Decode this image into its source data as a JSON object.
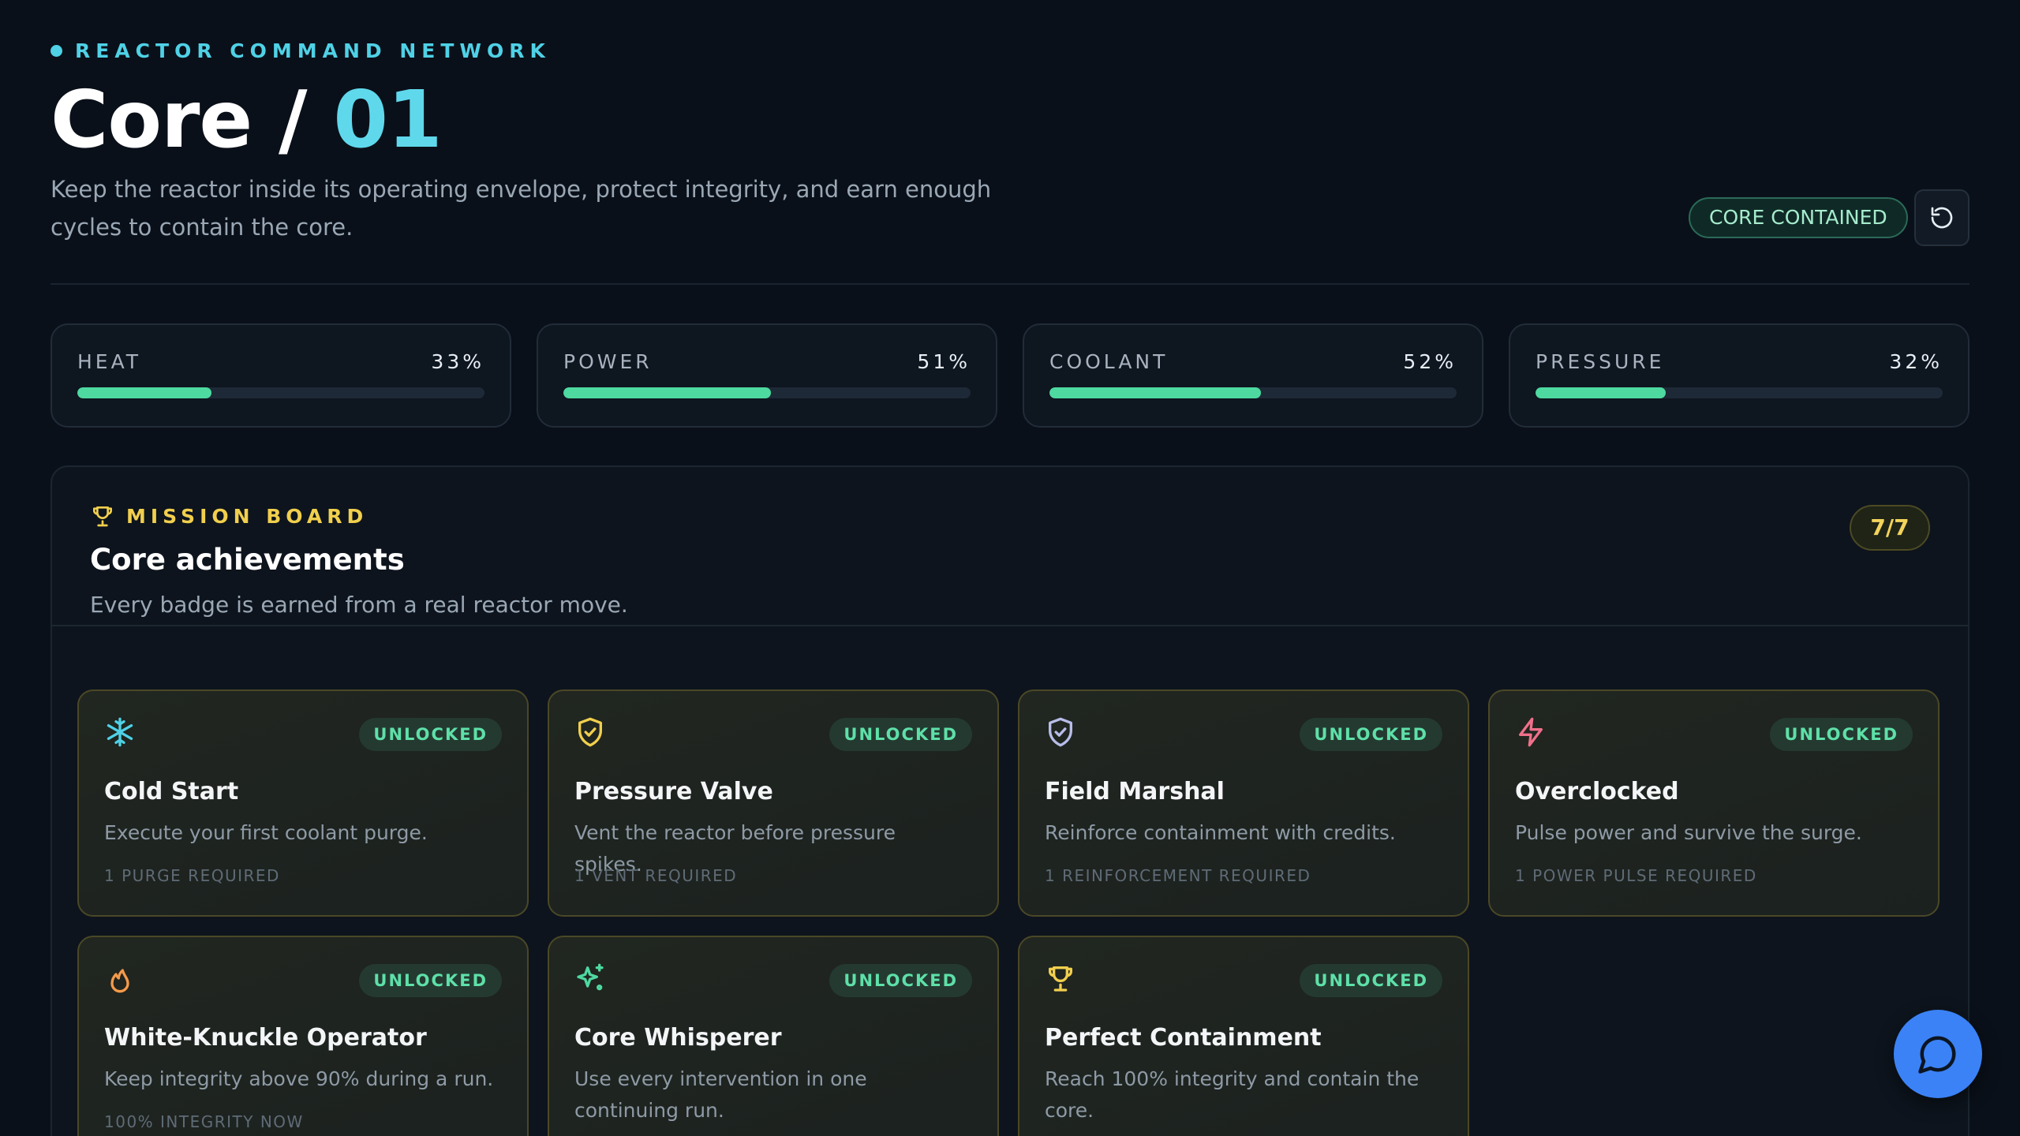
{
  "header": {
    "eyebrow": "REACTOR COMMAND NETWORK",
    "title_main": "Core / ",
    "title_accent": "01",
    "subtitle": "Keep the reactor inside its operating envelope, protect integrity, and earn enough cycles to contain the core.",
    "status": "CORE CONTAINED",
    "reset_icon": "reset-icon"
  },
  "meters": [
    {
      "label": "HEAT",
      "value_text": "33%",
      "value": 0.33
    },
    {
      "label": "POWER",
      "value_text": "51%",
      "value": 0.51
    },
    {
      "label": "COOLANT",
      "value_text": "52%",
      "value": 0.52
    },
    {
      "label": "PRESSURE",
      "value_text": "32%",
      "value": 0.32
    }
  ],
  "board": {
    "eyebrow": "MISSION BOARD",
    "title": "Core achievements",
    "subtitle": "Every badge is earned from a real reactor move.",
    "count": "7/7"
  },
  "achievements": [
    {
      "icon": "snowflake-icon",
      "status": "UNLOCKED",
      "title": "Cold Start",
      "desc": "Execute your first coolant purge.",
      "req": "1 PURGE REQUIRED"
    },
    {
      "icon": "shield-check-icon",
      "status": "UNLOCKED",
      "title": "Pressure Valve",
      "desc": "Vent the reactor before pressure spikes.",
      "req": "1 VENT REQUIRED"
    },
    {
      "icon": "shield-check-icon",
      "status": "UNLOCKED",
      "title": "Field Marshal",
      "desc": "Reinforce containment with credits.",
      "req": "1 REINFORCEMENT REQUIRED"
    },
    {
      "icon": "lightning-icon",
      "status": "UNLOCKED",
      "title": "Overclocked",
      "desc": "Pulse power and survive the surge.",
      "req": "1 POWER PULSE REQUIRED"
    },
    {
      "icon": "flame-icon",
      "status": "UNLOCKED",
      "title": "White-Knuckle Operator",
      "desc": "Keep integrity above 90% during a run.",
      "req": "100% INTEGRITY NOW"
    },
    {
      "icon": "sparkles-icon",
      "status": "UNLOCKED",
      "title": "Core Whisperer",
      "desc": "Use every intervention in one continuing run.",
      "req": ""
    },
    {
      "icon": "trophy-icon",
      "status": "UNLOCKED",
      "title": "Perfect Containment",
      "desc": "Reach 100% integrity and contain the core.",
      "req": ""
    }
  ],
  "chat": {
    "icon": "chat-bubble-icon"
  },
  "colors": {
    "accent": "#5fd8ec",
    "meter_fill": "#4ed9a0",
    "gold": "#f1cf4d",
    "chat": "#3b82f6"
  }
}
